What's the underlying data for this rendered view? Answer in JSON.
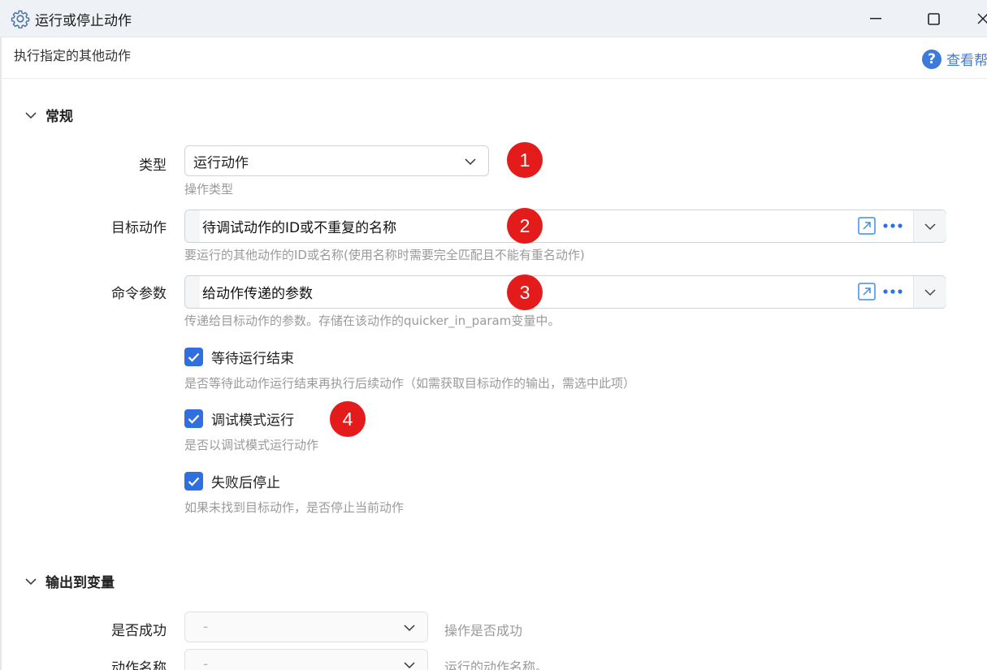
{
  "window": {
    "title": "运行或停止动作",
    "subtitle": "执行指定的其他动作",
    "help_label": "查看帮"
  },
  "sections": {
    "general": "常规",
    "output": "输出到变量"
  },
  "fields": {
    "type": {
      "label": "类型",
      "value": "运行动作",
      "hint": "操作类型"
    },
    "target": {
      "label": "目标动作",
      "placeholder": "待调试动作的ID或不重复的名称",
      "hint": "要运行的其他动作的ID或名称(使用名称时需要完全匹配且不能有重名动作)"
    },
    "params": {
      "label": "命令参数",
      "placeholder": "给动作传递的参数",
      "hint": "传递给目标动作的参数。存储在该动作的quicker_in_param变量中。"
    }
  },
  "checkboxes": [
    {
      "label": "等待运行结束",
      "checked": true,
      "hint": "是否等待此动作运行结束再执行后续动作（如需获取目标动作的输出，需选中此项）"
    },
    {
      "label": "调试模式运行",
      "checked": true,
      "hint": "是否以调试模式运行动作"
    },
    {
      "label": "失败后停止",
      "checked": true,
      "hint": "如果未找到目标动作，是否停止当前动作"
    }
  ],
  "outputs": [
    {
      "label": "是否成功",
      "value": "-",
      "hint": "操作是否成功"
    },
    {
      "label": "动作名称",
      "value": "-",
      "hint": "运行的动作名称。"
    }
  ],
  "badges": [
    "1",
    "2",
    "3",
    "4"
  ],
  "colors": {
    "accent": "#2f6fe0",
    "badge": "#e41b1b",
    "link": "#3d7ad9"
  },
  "icons": {
    "title": "gear-icon",
    "help": "question-circle-icon",
    "open": "open-external-icon",
    "more": "more-dots-icon"
  }
}
